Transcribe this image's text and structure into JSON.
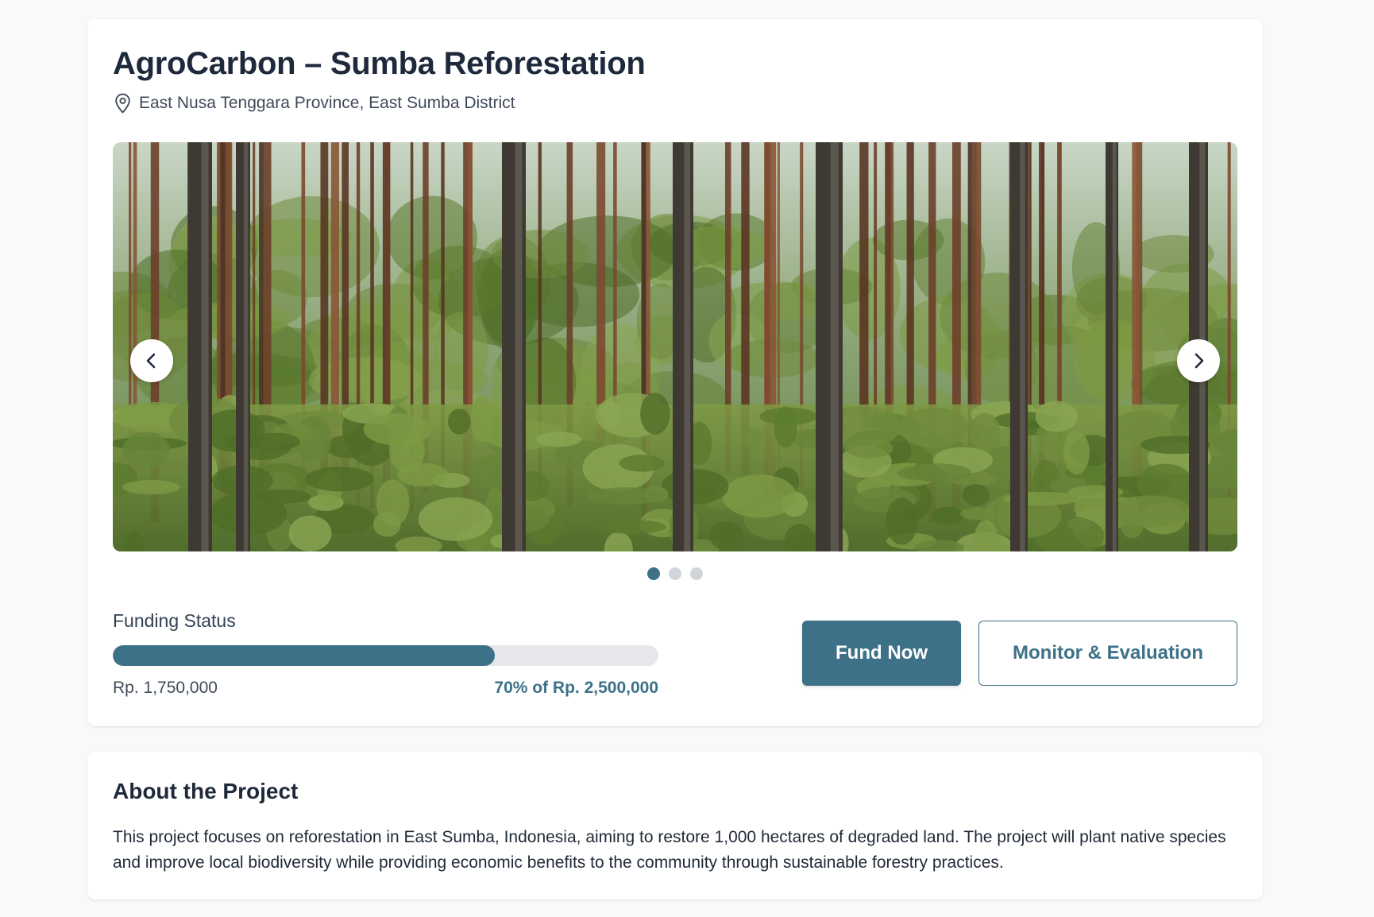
{
  "project": {
    "title": "AgroCarbon – Sumba Reforestation",
    "location": "East Nusa Tenggara Province, East Sumba District"
  },
  "carousel": {
    "image_subject": "pine forest",
    "slide_count": 3,
    "active_slide": 1
  },
  "funding": {
    "label": "Funding Status",
    "raised_text": "Rp. 1,750,000",
    "target_text": "70% of Rp. 2,500,000",
    "progress_fraction": 0.7
  },
  "actions": {
    "fund_label": "Fund Now",
    "monitor_label": "Monitor & Evaluation"
  },
  "about": {
    "title": "About the Project",
    "body": "This project focuses on reforestation in East Sumba, Indonesia, aiming to restore 1,000 hectares of degraded land. The project will plant native species and improve local biodiversity while providing economic benefits to the community through sustainable forestry practices."
  },
  "colors": {
    "accent": "#3d7187",
    "page_background": "#f8f9fb",
    "track": "#e5e7eb",
    "inactive_dot": "#d1d5db"
  },
  "icons": {
    "location": "map-pin-icon",
    "prev": "chevron-left-icon",
    "next": "chevron-right-icon"
  }
}
